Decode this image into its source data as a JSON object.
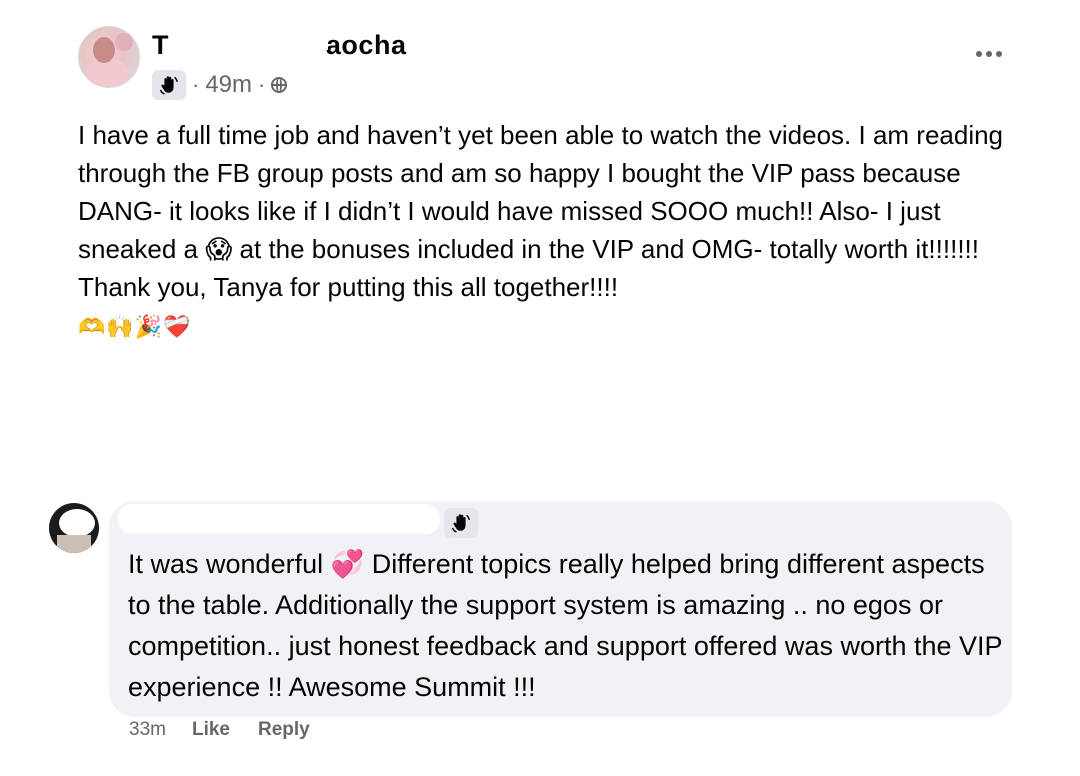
{
  "post": {
    "author_name": "T",
    "author_name_tail": "'aocha",
    "time": "49m",
    "separator": "·",
    "audience_icon": "globe-icon",
    "badge_icon": "wave-hand-icon",
    "more_icon": "more-horizontal-icon",
    "text": "I have a full time job and haven’t yet been able to watch the videos. I am reading through the FB group posts and am so happy I bought the VIP pass because DANG- it looks like if I didn’t I would have missed SOOO much!! Also- I just sneaked a 😱 at the bonuses included in the VIP and OMG- totally worth it!!!!!!! Thank you, Tanya for putting this all together!!!!",
    "emojis": "🫶🙌🎉❤️‍🩹"
  },
  "comment": {
    "badge_icon": "wave-hand-icon",
    "text": "It was wonderful 💞 Different topics really helped bring different aspects to the table. Additionally the support system is amazing .. no egos or competition.. just honest feedback and support offered was worth the VIP experience !! Awesome Summit !!!",
    "time": "33m",
    "like_label": "Like",
    "reply_label": "Reply"
  }
}
